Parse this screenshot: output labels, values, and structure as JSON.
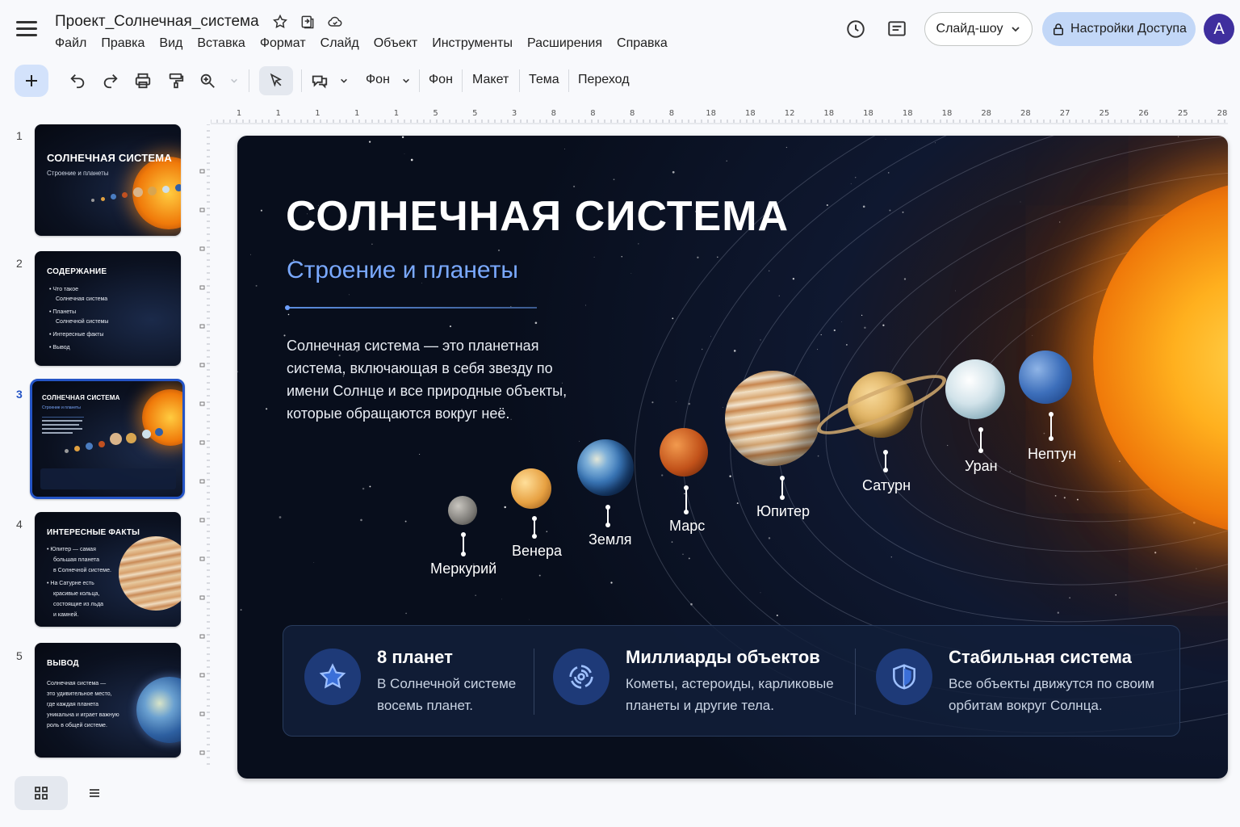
{
  "header": {
    "doc_title": "Проект_Солнечная_система",
    "menu": [
      "Файл",
      "Правка",
      "Вид",
      "Вставка",
      "Формат",
      "Слайд",
      "Объект",
      "Инструменты",
      "Расширения",
      "Справка"
    ],
    "slideshow_label": "Слайд-шоу",
    "access_label": "Настройки Доступа",
    "avatar_letter": "A"
  },
  "toolbar": {
    "background_select": "Фон",
    "items": [
      "Фон",
      "Макет",
      "Тема",
      "Переход"
    ]
  },
  "ruler": {
    "labels": [
      "1",
      "1",
      "1",
      "1",
      "1",
      "5",
      "5",
      "3",
      "8",
      "8",
      "8",
      "8",
      "18",
      "18",
      "12",
      "18",
      "18",
      "18",
      "18",
      "28",
      "28",
      "27",
      "25",
      "26",
      "25",
      "28"
    ]
  },
  "thumbnails": [
    {
      "number": "1",
      "title": "СОЛНЕЧНАЯ СИСТЕМА",
      "subtitle": "Строение и планеты"
    },
    {
      "number": "2",
      "title": "СОДЕРЖАНИЕ",
      "bullets": [
        "• Что такое",
        "Солнечная система",
        "• Планеты",
        "Солнечной системы",
        "• Интересные факты",
        "• Вывод"
      ]
    },
    {
      "number": "3",
      "title": "СОЛНЕЧНАЯ СИСТЕМА",
      "subtitle": "Строение и планеты"
    },
    {
      "number": "4",
      "title": "ИНТЕРЕСНЫЕ ФАКТЫ",
      "bullets": [
        "• Юпитер — самая",
        "большая планета",
        "в Солнечной системе.",
        "• На Сатурне есть",
        "красивые кольца,",
        "состоящие из льда",
        "и камней."
      ]
    },
    {
      "number": "5",
      "title": "ВЫВОД",
      "bullets": [
        "Солнечная система —",
        "это удивительное место,",
        "где каждая планета",
        "уникальна и играет важную",
        "роль в общей системе."
      ]
    }
  ],
  "slide": {
    "title": "СОЛНЕЧНАЯ СИСТЕМА",
    "subtitle": "Строение и планеты",
    "text": "Солнечная система — это планетная система, включающая в себя звезду по имени Солнце и все природные объекты, которые обращаются вокруг неё.",
    "planets": [
      "Меркурий",
      "Венера",
      "Земля",
      "Марс",
      "Юпитер",
      "Сатурн",
      "Уран",
      "Нептун"
    ],
    "info": [
      {
        "title": "8 планет",
        "text": "В Солнечной системе восемь планет.",
        "icon": "star-icon"
      },
      {
        "title": "Миллиарды объектов",
        "text": "Кометы, астероиды, карликовые планеты и другие тела.",
        "icon": "galaxy-icon"
      },
      {
        "title": "Стабильная система",
        "text": "Все объекты движутся по своим орбитам вокруг Солнца.",
        "icon": "shield-icon"
      }
    ]
  },
  "colors": {
    "accent": "#2454c6",
    "subtitle_blue": "#7aa9ff",
    "access_button": "#c2d7f7",
    "avatar": "#3f2f9e"
  }
}
